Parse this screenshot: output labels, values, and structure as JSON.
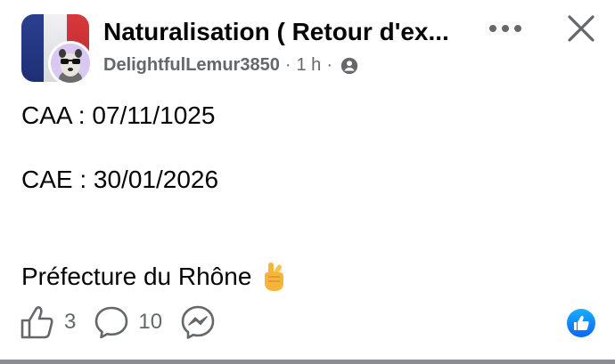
{
  "post": {
    "group_title": "Naturalisation ( Retour d'ex...",
    "author": "DelightfulLemur3850",
    "time": "1 h",
    "separator": "·",
    "privacy_icon": "globe-icon",
    "lines": [
      "CAA : 07/11/1025",
      "CAE : 30/01/2026",
      "Préfecture du Rhône"
    ],
    "emoji": "crossed-fingers"
  },
  "actions": {
    "like_icon": "thumbs-up-icon",
    "like_count": "3",
    "comment_icon": "comment-icon",
    "comment_count": "10",
    "share_icon": "messenger-icon",
    "reaction_badge": "like-reaction-icon"
  },
  "header_buttons": {
    "more_icon": "more-icon",
    "close_icon": "close-icon"
  },
  "colors": {
    "flag_blue": "#1e2f74",
    "flag_white": "#e8e9ec",
    "flag_red": "#c8302f",
    "meta_gray": "#65676b",
    "like_blue": "#1877f2"
  }
}
